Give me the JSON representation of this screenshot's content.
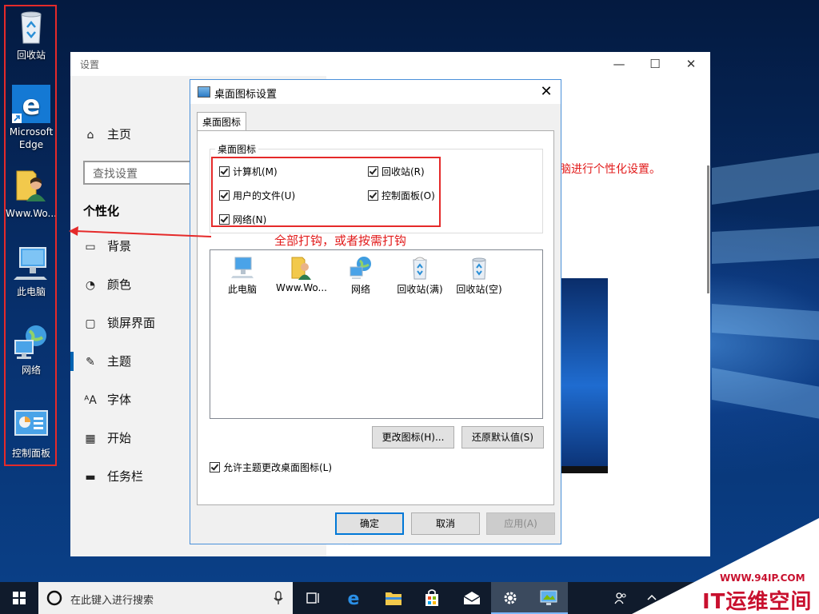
{
  "desktop": {
    "icons": [
      {
        "label": "回收站"
      },
      {
        "label": "Microsoft Edge"
      },
      {
        "label": "Www.Wo..."
      },
      {
        "label": "此电脑"
      },
      {
        "label": "网络"
      },
      {
        "label": "控制面板"
      }
    ]
  },
  "settings": {
    "title": "设置",
    "controls": {
      "minimize": "—",
      "maximize": "☐",
      "close": "✕"
    },
    "nav": {
      "home": "主页",
      "search_placeholder": "查找设置",
      "section": "个性化",
      "items": [
        {
          "label": "背景",
          "icon": "image-icon"
        },
        {
          "label": "颜色",
          "icon": "palette-icon"
        },
        {
          "label": "锁屏界面",
          "icon": "lockscreen-icon"
        },
        {
          "label": "主题",
          "icon": "theme-icon",
          "active": true
        },
        {
          "label": "字体",
          "icon": "font-icon"
        },
        {
          "label": "开始",
          "icon": "start-icon"
        },
        {
          "label": "任务栏",
          "icon": "taskbar-icon"
        }
      ]
    },
    "content_text": "脑进行个性化设置。",
    "bottom_item": "颜色"
  },
  "dialog": {
    "title": "桌面图标设置",
    "close": "✕",
    "tab": "桌面图标",
    "group_legend": "桌面图标",
    "checkboxes": [
      {
        "label": "计算机(M)",
        "checked": true
      },
      {
        "label": "回收站(R)",
        "checked": true
      },
      {
        "label": "用户的文件(U)",
        "checked": true
      },
      {
        "label": "控制面板(O)",
        "checked": true
      },
      {
        "label": "网络(N)",
        "checked": true
      }
    ],
    "annotation": "全部打钩，或者按需打钩",
    "icon_list": [
      "此电脑",
      "Www.Wo...",
      "网络",
      "回收站(满)",
      "回收站(空)"
    ],
    "change_icon": "更改图标(H)...",
    "restore_default": "还原默认值(S)",
    "allow_theme": {
      "label": "允许主题更改桌面图标(L)",
      "checked": true
    },
    "ok": "确定",
    "cancel": "取消",
    "apply": "应用(A)"
  },
  "taskbar": {
    "search_placeholder": "在此键入进行搜索"
  },
  "watermark": {
    "url": "WWW.94IP.COM",
    "brand": "IT运维空间"
  },
  "colors": {
    "annotation_red": "#e52a2a",
    "accent": "#0078d7"
  }
}
